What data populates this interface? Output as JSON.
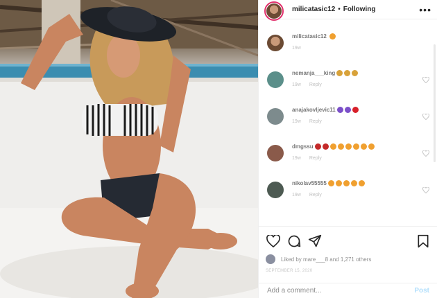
{
  "header": {
    "username": "milicatasic12",
    "separator": "•",
    "follow_label": "Following",
    "more_icon": "more-horizontal-icon"
  },
  "caption": {
    "username": "milicatasic12",
    "time": "19w"
  },
  "comments": [
    {
      "username": "nemanja___king",
      "time": "19w",
      "reply": "Reply",
      "emojis": [
        "#d8a23a",
        "#d8a23a",
        "#d8a23a"
      ],
      "avatar": "#5b8f8a"
    },
    {
      "username": "anajakovljevic11",
      "time": "19w",
      "reply": "Reply",
      "emojis": [
        "#7b4fc9",
        "#7b4fc9",
        "#d8202a"
      ],
      "avatar": "#7d8b8d"
    },
    {
      "username": "dmgssu",
      "time": "19w",
      "reply": "Reply",
      "emojis": [
        "#c42a2a",
        "#c42a2a",
        "#f0a030",
        "#f0a030",
        "#f0a030",
        "#f0a030",
        "#f0a030",
        "#f0a030"
      ],
      "avatar": "#8a5a4a"
    },
    {
      "username": "nikolav55555",
      "time": "19w",
      "reply": "Reply",
      "emojis": [
        "#f0a030",
        "#f0a030",
        "#f0a030",
        "#f0a030",
        "#f0a030"
      ],
      "avatar": "#4d5a52"
    }
  ],
  "likes": {
    "text": "Liked by mare___8 and 1,271 others"
  },
  "date": "SEPTEMBER 15, 2020",
  "add_comment": {
    "placeholder": "Add a comment...",
    "post_label": "Post"
  },
  "colors": {
    "accent": "#0095f6",
    "post_disabled": "#b2dffc",
    "story_ring": "#e1306c"
  }
}
